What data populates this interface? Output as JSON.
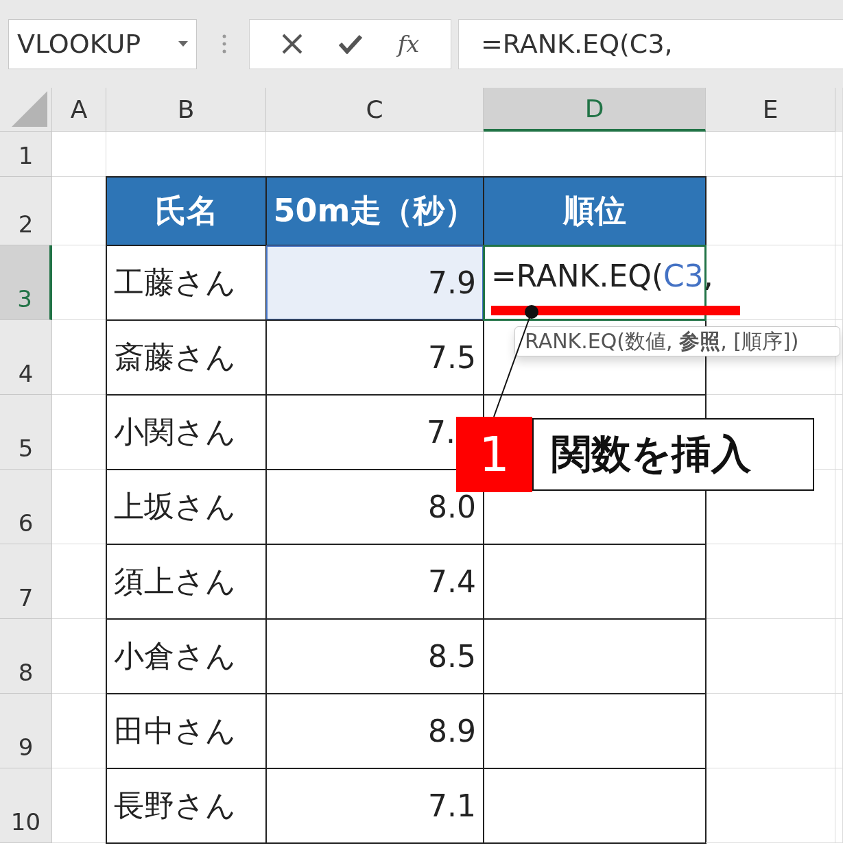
{
  "name_box": {
    "value": "VLOOKUP"
  },
  "formula_bar": {
    "function_label": "fx",
    "formula": "=RANK.EQ(C3,"
  },
  "columns": [
    {
      "label": "A",
      "selected": false
    },
    {
      "label": "B",
      "selected": false
    },
    {
      "label": "C",
      "selected": false
    },
    {
      "label": "D",
      "selected": true
    },
    {
      "label": "E",
      "selected": false
    }
  ],
  "row_headers": [
    {
      "label": "1",
      "selected": false
    },
    {
      "label": "2",
      "selected": false
    },
    {
      "label": "3",
      "selected": true
    },
    {
      "label": "4",
      "selected": false
    },
    {
      "label": "5",
      "selected": false
    },
    {
      "label": "6",
      "selected": false
    },
    {
      "label": "7",
      "selected": false
    },
    {
      "label": "8",
      "selected": false
    },
    {
      "label": "9",
      "selected": false
    },
    {
      "label": "10",
      "selected": false
    }
  ],
  "table": {
    "headers": [
      "氏名",
      "50m走（秒）",
      "順位"
    ],
    "rows": [
      {
        "name": "工藤さん",
        "time": "7.9",
        "time_in_range": true,
        "rank_formula": [
          {
            "text": "=RANK.EQ(",
            "kind": "plain"
          },
          {
            "text": "C3",
            "kind": "reference"
          },
          {
            "text": ",",
            "kind": "plain"
          }
        ]
      },
      {
        "name": "斎藤さん",
        "time": "7.5",
        "time_in_range": false
      },
      {
        "name": "小関さん",
        "time": "7.",
        "time_in_range": false,
        "partly_hidden": true
      },
      {
        "name": "上坂さん",
        "time": "8.0",
        "time_in_range": false
      },
      {
        "name": "須上さん",
        "time": "7.4",
        "time_in_range": false
      },
      {
        "name": "小倉さん",
        "time": "8.5",
        "time_in_range": false
      },
      {
        "name": "田中さん",
        "time": "8.9",
        "time_in_range": false
      },
      {
        "name": "長野さん",
        "time": "7.1",
        "time_in_range": false
      }
    ]
  },
  "tooltip": {
    "text": "RANK.EQ(数値, **参照**, [順序])"
  },
  "callout": {
    "number": "1",
    "text": "関数を挿入"
  }
}
